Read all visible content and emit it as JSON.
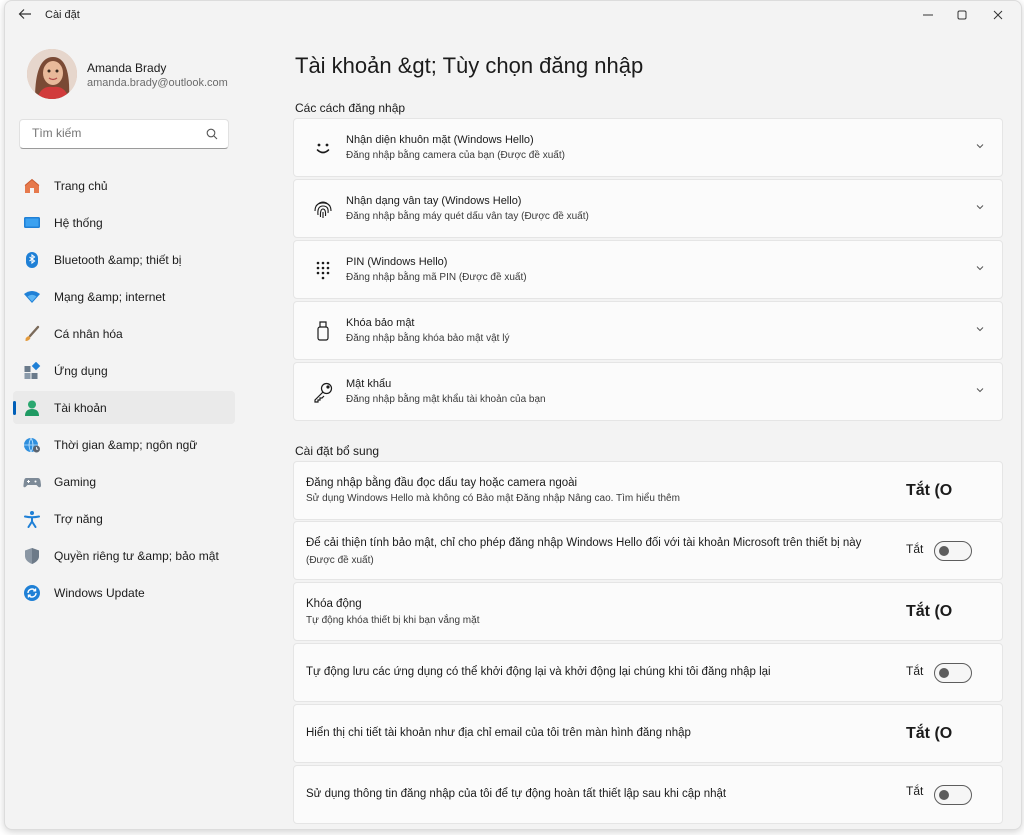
{
  "window": {
    "title": "Cài đặt",
    "back_icon": "back-arrow-icon",
    "controls": [
      "minimize-icon",
      "maximize-icon",
      "close-icon"
    ]
  },
  "user": {
    "name": "Amanda Brady",
    "email": "amanda.brady@outlook.com"
  },
  "search": {
    "placeholder": "Tìm kiếm",
    "icon": "search-icon"
  },
  "nav": {
    "items": [
      {
        "label": "Trang chủ",
        "icon": "home-icon"
      },
      {
        "label": "Hệ thống",
        "icon": "system-icon"
      },
      {
        "label": "Bluetooth &amp; thiết bị",
        "icon": "bluetooth-icon"
      },
      {
        "label": "Mạng &amp; internet",
        "icon": "wifi-icon"
      },
      {
        "label": "Cá nhân hóa",
        "icon": "brush-icon"
      },
      {
        "label": "Ứng dụng",
        "icon": "apps-icon"
      },
      {
        "label": "Tài khoản",
        "icon": "account-icon"
      },
      {
        "label": "Thời gian &amp; ngôn ngữ",
        "icon": "globe-clock-icon"
      },
      {
        "label": "Gaming",
        "icon": "gamepad-icon"
      },
      {
        "label": "Trợ năng",
        "icon": "accessibility-icon"
      },
      {
        "label": "Quyền riêng tư &amp; bảo mật",
        "icon": "shield-icon"
      },
      {
        "label": "Windows Update",
        "icon": "update-icon"
      }
    ],
    "active": "Tài khoản"
  },
  "page": {
    "title": "Tài khoản &gt;  Tùy chọn đăng nhập"
  },
  "signin_methods": {
    "heading": "Các cách đăng nhập",
    "items": [
      {
        "title": "Nhận diện khuôn mặt (Windows Hello)",
        "subtitle": "Đăng nhập bằng camera của bạn (Được đề xuất)",
        "icon": "face-icon"
      },
      {
        "title": "Nhận dạng vân tay (Windows Hello)",
        "subtitle": "Đăng nhập bằng máy quét dấu vân tay (Được đề xuất)",
        "icon": "fingerprint-icon"
      },
      {
        "title": "PIN (Windows Hello)",
        "subtitle": "Đăng nhập bằng mã PIN (Được đề xuất)",
        "icon": "pin-keypad-icon"
      },
      {
        "title": "Khóa bảo mật",
        "subtitle": "Đăng nhập bằng khóa bảo mật vật lý",
        "icon": "usb-key-icon"
      },
      {
        "title": "Mật khẩu",
        "subtitle": "Đăng nhập bằng mật khẩu tài khoản của bạn",
        "icon": "key-icon"
      }
    ]
  },
  "additional": {
    "heading": "Cài đặt bổ sung",
    "items": [
      {
        "title": "Đăng nhập bằng đầu đọc dấu tay hoặc camera ngoài",
        "subtitle": "Sử dụng Windows Hello mà không có Bảo mật Đăng nhập Nâng cao. Tìm hiểu thêm",
        "state_label": "Tắt (O"
      },
      {
        "title": "Để cải thiện tính bảo mật, chỉ cho phép đăng nhập Windows Hello đối với tài khoản Microsoft trên thiết bị này",
        "subtitle": "(Được đề xuất)",
        "state_label": "Tắt",
        "toggle_on": false
      },
      {
        "title": "Khóa động",
        "subtitle": "Tự động khóa thiết bị khi bạn vắng mặt",
        "state_label": "Tắt (O"
      },
      {
        "title": "Tự động lưu các ứng dụng có thể khởi động lại và khởi động lại chúng khi tôi đăng nhập lại",
        "state_label": "Tắt",
        "toggle_on": false
      },
      {
        "title": "Hiển thị chi tiết tài khoản như địa chỉ email của tôi trên màn hình đăng nhập",
        "state_label": "Tắt (O"
      },
      {
        "title": "Sử dụng thông tin đăng nhập của tôi để tự động hoàn tất thiết lập sau khi cập nhật",
        "state_label": "Tắt",
        "toggle_on": false
      }
    ]
  },
  "colors": {
    "accent": "#005fb8",
    "background": "#f3f3f3",
    "card": "#fbfbfb"
  }
}
